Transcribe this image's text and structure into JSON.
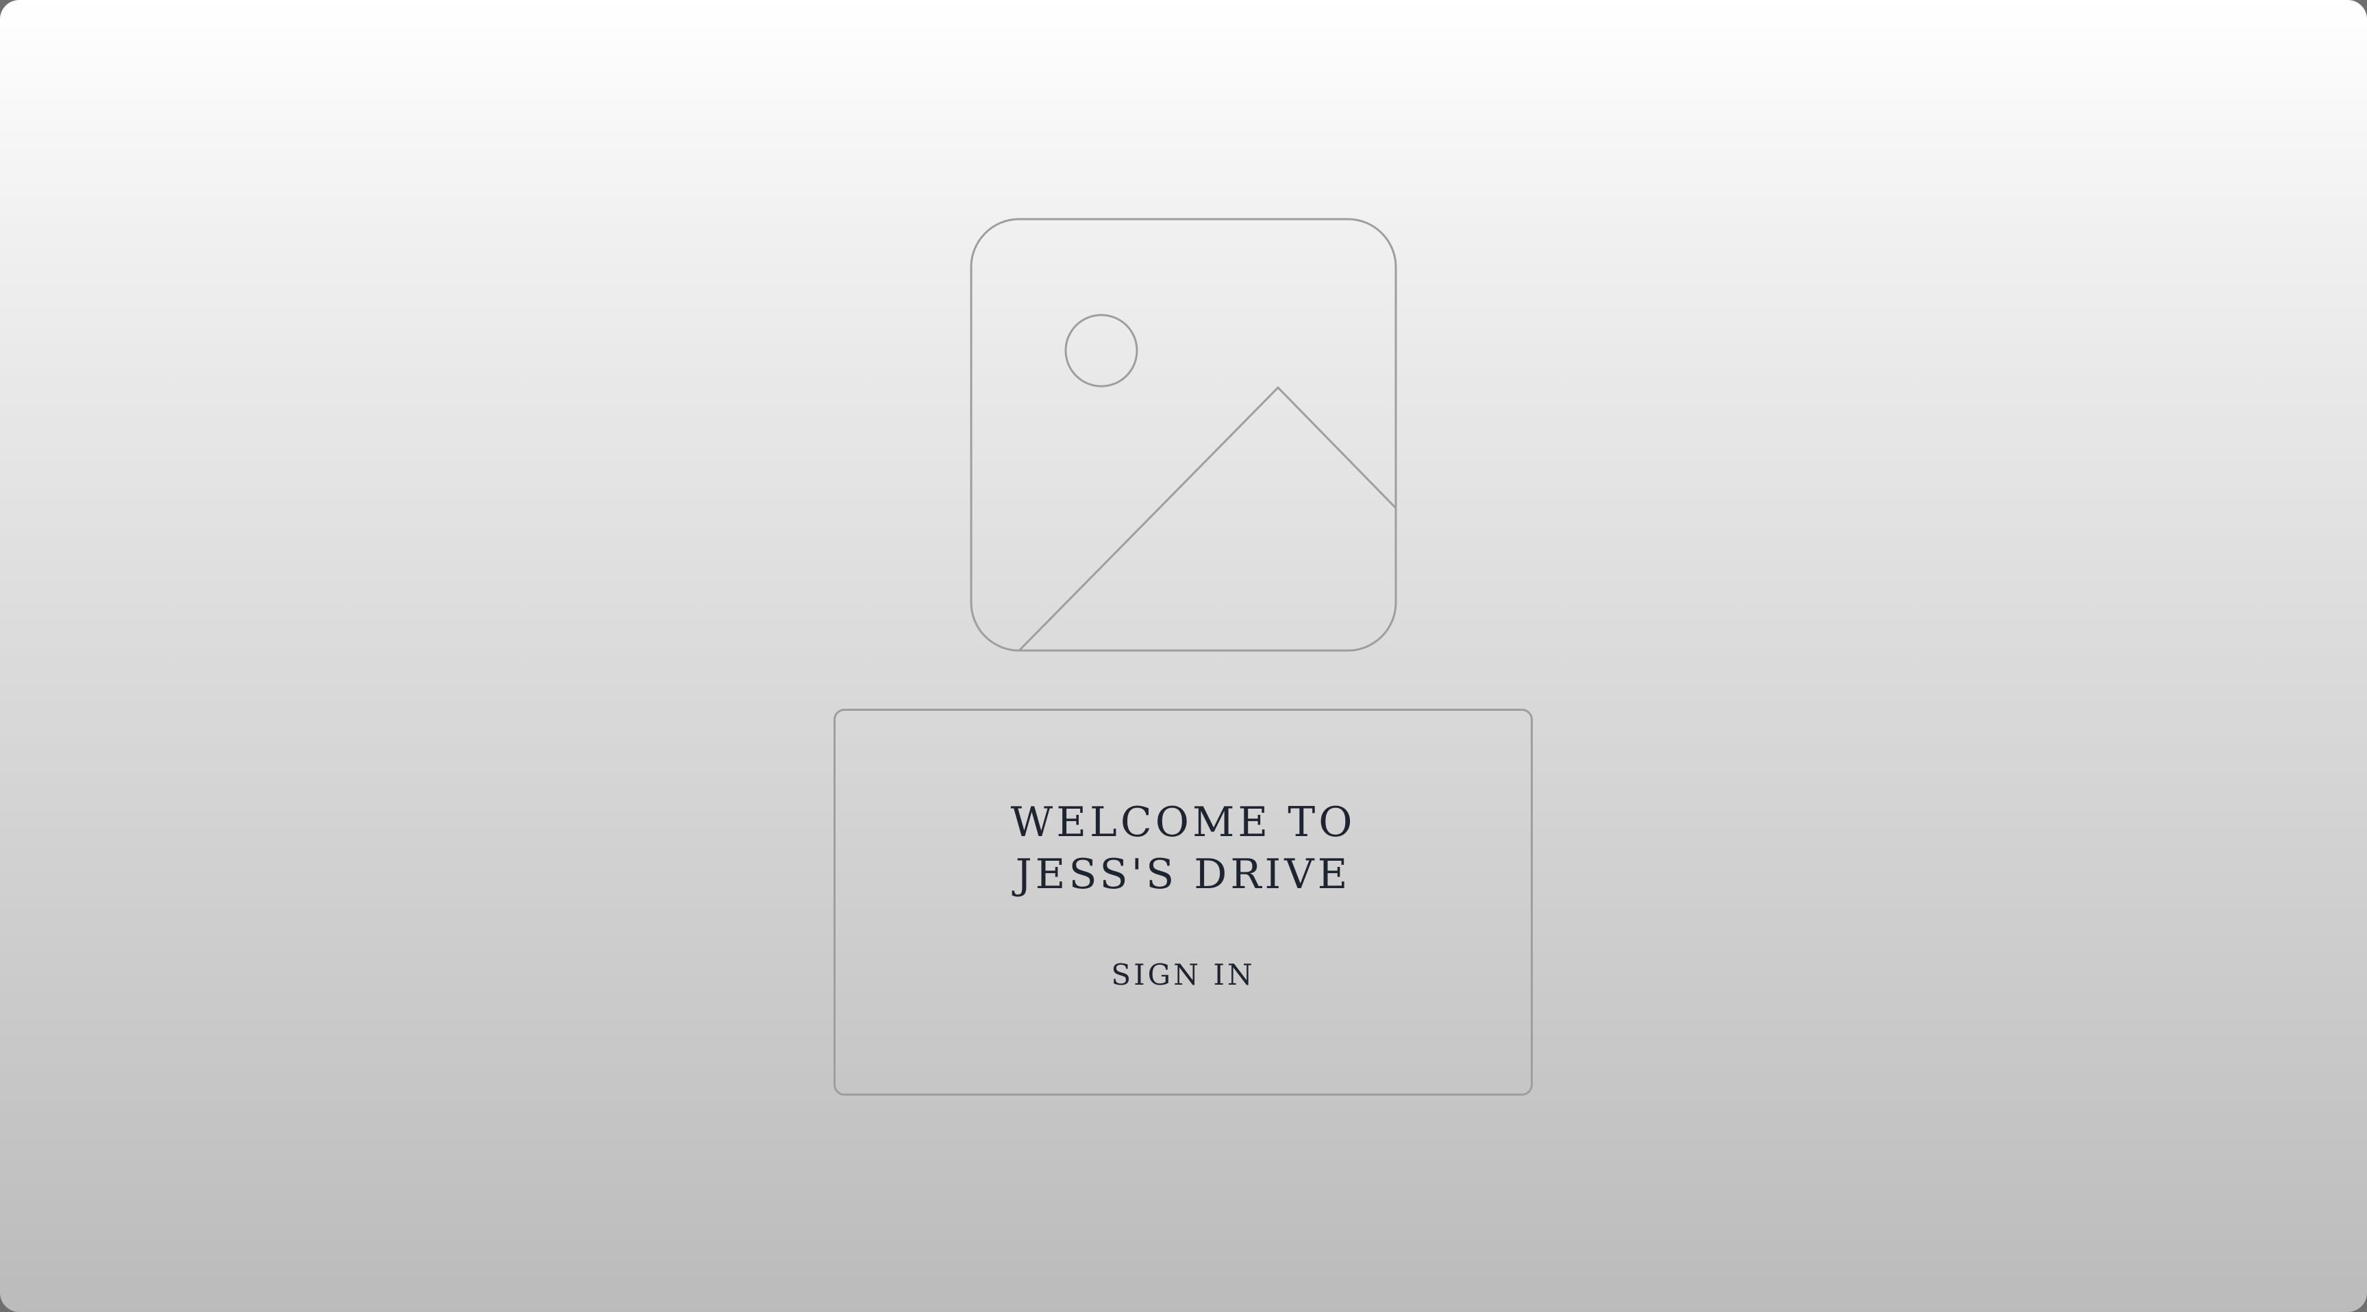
{
  "welcome": {
    "line1": "WELCOME TO",
    "line2": "JESS'S DRIVE"
  },
  "actions": {
    "sign_in_label": "SIGN IN"
  },
  "colors": {
    "text": "#1f2530",
    "outline": "#9e9e9e",
    "background_top": "#ffffff",
    "background_bottom": "#bbbbbb"
  },
  "icons": {
    "hero": "image-placeholder-icon"
  }
}
